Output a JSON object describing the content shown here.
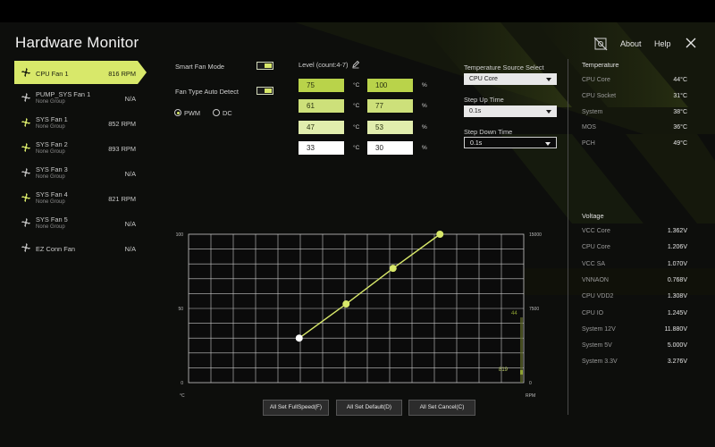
{
  "colors": {
    "accent": "#d8e86a",
    "accent_dark": "#8fa332",
    "background": "#0d0e0c",
    "grid": "#c8c8c8"
  },
  "header": {
    "title": "Hardware Monitor",
    "about": "About",
    "help": "Help",
    "icons": [
      "fan-off-icon",
      "close-icon"
    ]
  },
  "fans": [
    {
      "name": "CPU Fan 1",
      "group": "",
      "rpm": "816 RPM",
      "selected": true
    },
    {
      "name": "PUMP_SYS Fan 1",
      "group": "None Group",
      "rpm": "N/A"
    },
    {
      "name": "SYS Fan 1",
      "group": "None Group",
      "rpm": "852 RPM"
    },
    {
      "name": "SYS Fan 2",
      "group": "None Group",
      "rpm": "893 RPM"
    },
    {
      "name": "SYS Fan 3",
      "group": "None Group",
      "rpm": "N/A"
    },
    {
      "name": "SYS Fan 4",
      "group": "None Group",
      "rpm": "821 RPM"
    },
    {
      "name": "SYS Fan 5",
      "group": "None Group",
      "rpm": "N/A"
    },
    {
      "name": "EZ Conn Fan",
      "group": "",
      "rpm": "N/A"
    }
  ],
  "controls": {
    "smart_fan_mode": "Smart Fan Mode",
    "fan_type": "Fan Type Auto Detect",
    "pwm": "PWM",
    "dc": "DC",
    "level_label": "Level (count:4-7)",
    "temp_unit": "°C",
    "pct_unit": "%",
    "levels": [
      {
        "temp": "75",
        "speed": "100"
      },
      {
        "temp": "61",
        "speed": "77"
      },
      {
        "temp": "47",
        "speed": "53"
      },
      {
        "temp": "33",
        "speed": "30"
      }
    ]
  },
  "source": {
    "temp_source_label": "Temperature Source Select",
    "temp_source_value": "CPU Core",
    "step_up_label": "Step Up Time",
    "step_up_value": "0.1s",
    "step_down_label": "Step Down Time",
    "step_down_value": "0.1s"
  },
  "temperature": {
    "title": "Temperature",
    "items": [
      {
        "name": "CPU Core",
        "value": "44°C"
      },
      {
        "name": "CPU Socket",
        "value": "31°C"
      },
      {
        "name": "System",
        "value": "38°C"
      },
      {
        "name": "MOS",
        "value": "36°C"
      },
      {
        "name": "PCH",
        "value": "49°C"
      }
    ]
  },
  "voltage": {
    "title": "Voltage",
    "items": [
      {
        "name": "VCC Core",
        "value": "1.362V"
      },
      {
        "name": "CPU Core",
        "value": "1.206V"
      },
      {
        "name": "VCC SA",
        "value": "1.070V"
      },
      {
        "name": "VNNAON",
        "value": "0.768V"
      },
      {
        "name": "CPU VDD2",
        "value": "1.308V"
      },
      {
        "name": "CPU IO",
        "value": "1.245V"
      },
      {
        "name": "System 12V",
        "value": "11.880V"
      },
      {
        "name": "System 5V",
        "value": "5.000V"
      },
      {
        "name": "System 3.3V",
        "value": "3.276V"
      }
    ]
  },
  "chart_data": {
    "type": "line",
    "x": [
      33,
      47,
      61,
      75
    ],
    "values": [
      30,
      53,
      77,
      100
    ],
    "xlim": [
      0,
      100
    ],
    "ylim": [
      0,
      100
    ],
    "y_ticks": [
      "0",
      "50",
      "100"
    ],
    "right_ticks": [
      "0",
      "7500",
      "15000"
    ],
    "xlabel": "°C",
    "right_label": "RPM",
    "current_temp": "44",
    "current_rpm": "819",
    "current_temp_value": 44,
    "current_rpm_value": 819,
    "rpm_max": 15000,
    "grid": true
  },
  "buttons": {
    "full_speed": "All Set FullSpeed(F)",
    "default": "All Set Default(D)",
    "cancel": "All Set Cancel(C)"
  }
}
